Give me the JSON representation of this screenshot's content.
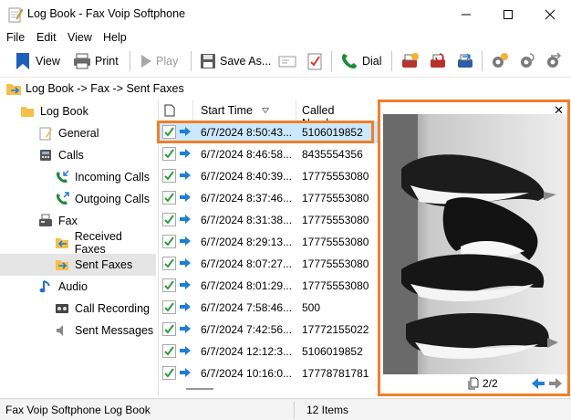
{
  "window": {
    "title": "Log Book - Fax Voip Softphone"
  },
  "menu": {
    "items": [
      "File",
      "Edit",
      "View",
      "Help"
    ]
  },
  "toolbar": {
    "view_label": "View",
    "print_label": "Print",
    "play_label": "Play",
    "save_as_label": "Save As...",
    "dial_label": "Dial"
  },
  "breadcrumb": {
    "path": "Log Book -> Fax -> Sent Faxes"
  },
  "tree": {
    "items": [
      {
        "label": "Log Book",
        "icon": "folder-icon"
      },
      {
        "label": "General",
        "icon": "notepad-icon"
      },
      {
        "label": "Calls",
        "icon": "phone-icon"
      },
      {
        "label": "Incoming Calls",
        "icon": "incoming-call-icon"
      },
      {
        "label": "Outgoing Calls",
        "icon": "outgoing-call-icon"
      },
      {
        "label": "Fax",
        "icon": "fax-icon"
      },
      {
        "label": "Received Faxes",
        "icon": "received-fax-folder-icon"
      },
      {
        "label": "Sent Faxes",
        "icon": "sent-fax-folder-icon"
      },
      {
        "label": "Audio",
        "icon": "music-note-icon"
      },
      {
        "label": "Call Recording",
        "icon": "tape-icon"
      },
      {
        "label": "Sent Messages",
        "icon": "speaker-icon"
      }
    ]
  },
  "list": {
    "columns": [
      "Start Time",
      "Called Number"
    ],
    "rows": [
      {
        "start_time": "6/7/2024 8:50:43...",
        "called_number": "5106019852"
      },
      {
        "start_time": "6/7/2024 8:46:58...",
        "called_number": "8435554356"
      },
      {
        "start_time": "6/7/2024 8:40:39...",
        "called_number": "17775553080"
      },
      {
        "start_time": "6/7/2024 8:37:46...",
        "called_number": "17775553080"
      },
      {
        "start_time": "6/7/2024 8:31:38...",
        "called_number": "17775553080"
      },
      {
        "start_time": "6/7/2024 8:29:13...",
        "called_number": "17775553080"
      },
      {
        "start_time": "6/7/2024 8:07:27...",
        "called_number": "17775553080"
      },
      {
        "start_time": "6/7/2024 8:01:29...",
        "called_number": "17775553080"
      },
      {
        "start_time": "6/7/2024 7:58:46...",
        "called_number": "500"
      },
      {
        "start_time": "6/7/2024 7:42:56...",
        "called_number": "17772155022"
      },
      {
        "start_time": "6/7/2024 12:12:3...",
        "called_number": "5106019852"
      },
      {
        "start_time": "6/7/2024 10:16:0...",
        "called_number": "17778781781"
      }
    ]
  },
  "preview": {
    "page_indicator": "2/2"
  },
  "status": {
    "left": "Fax Voip Softphone Log Book",
    "right": "12 Items"
  },
  "colors": {
    "highlight": "#f07f2a",
    "selection": "#cce8ff",
    "arrow_blue": "#1e7fd6",
    "check_green": "#2e9d3a"
  }
}
